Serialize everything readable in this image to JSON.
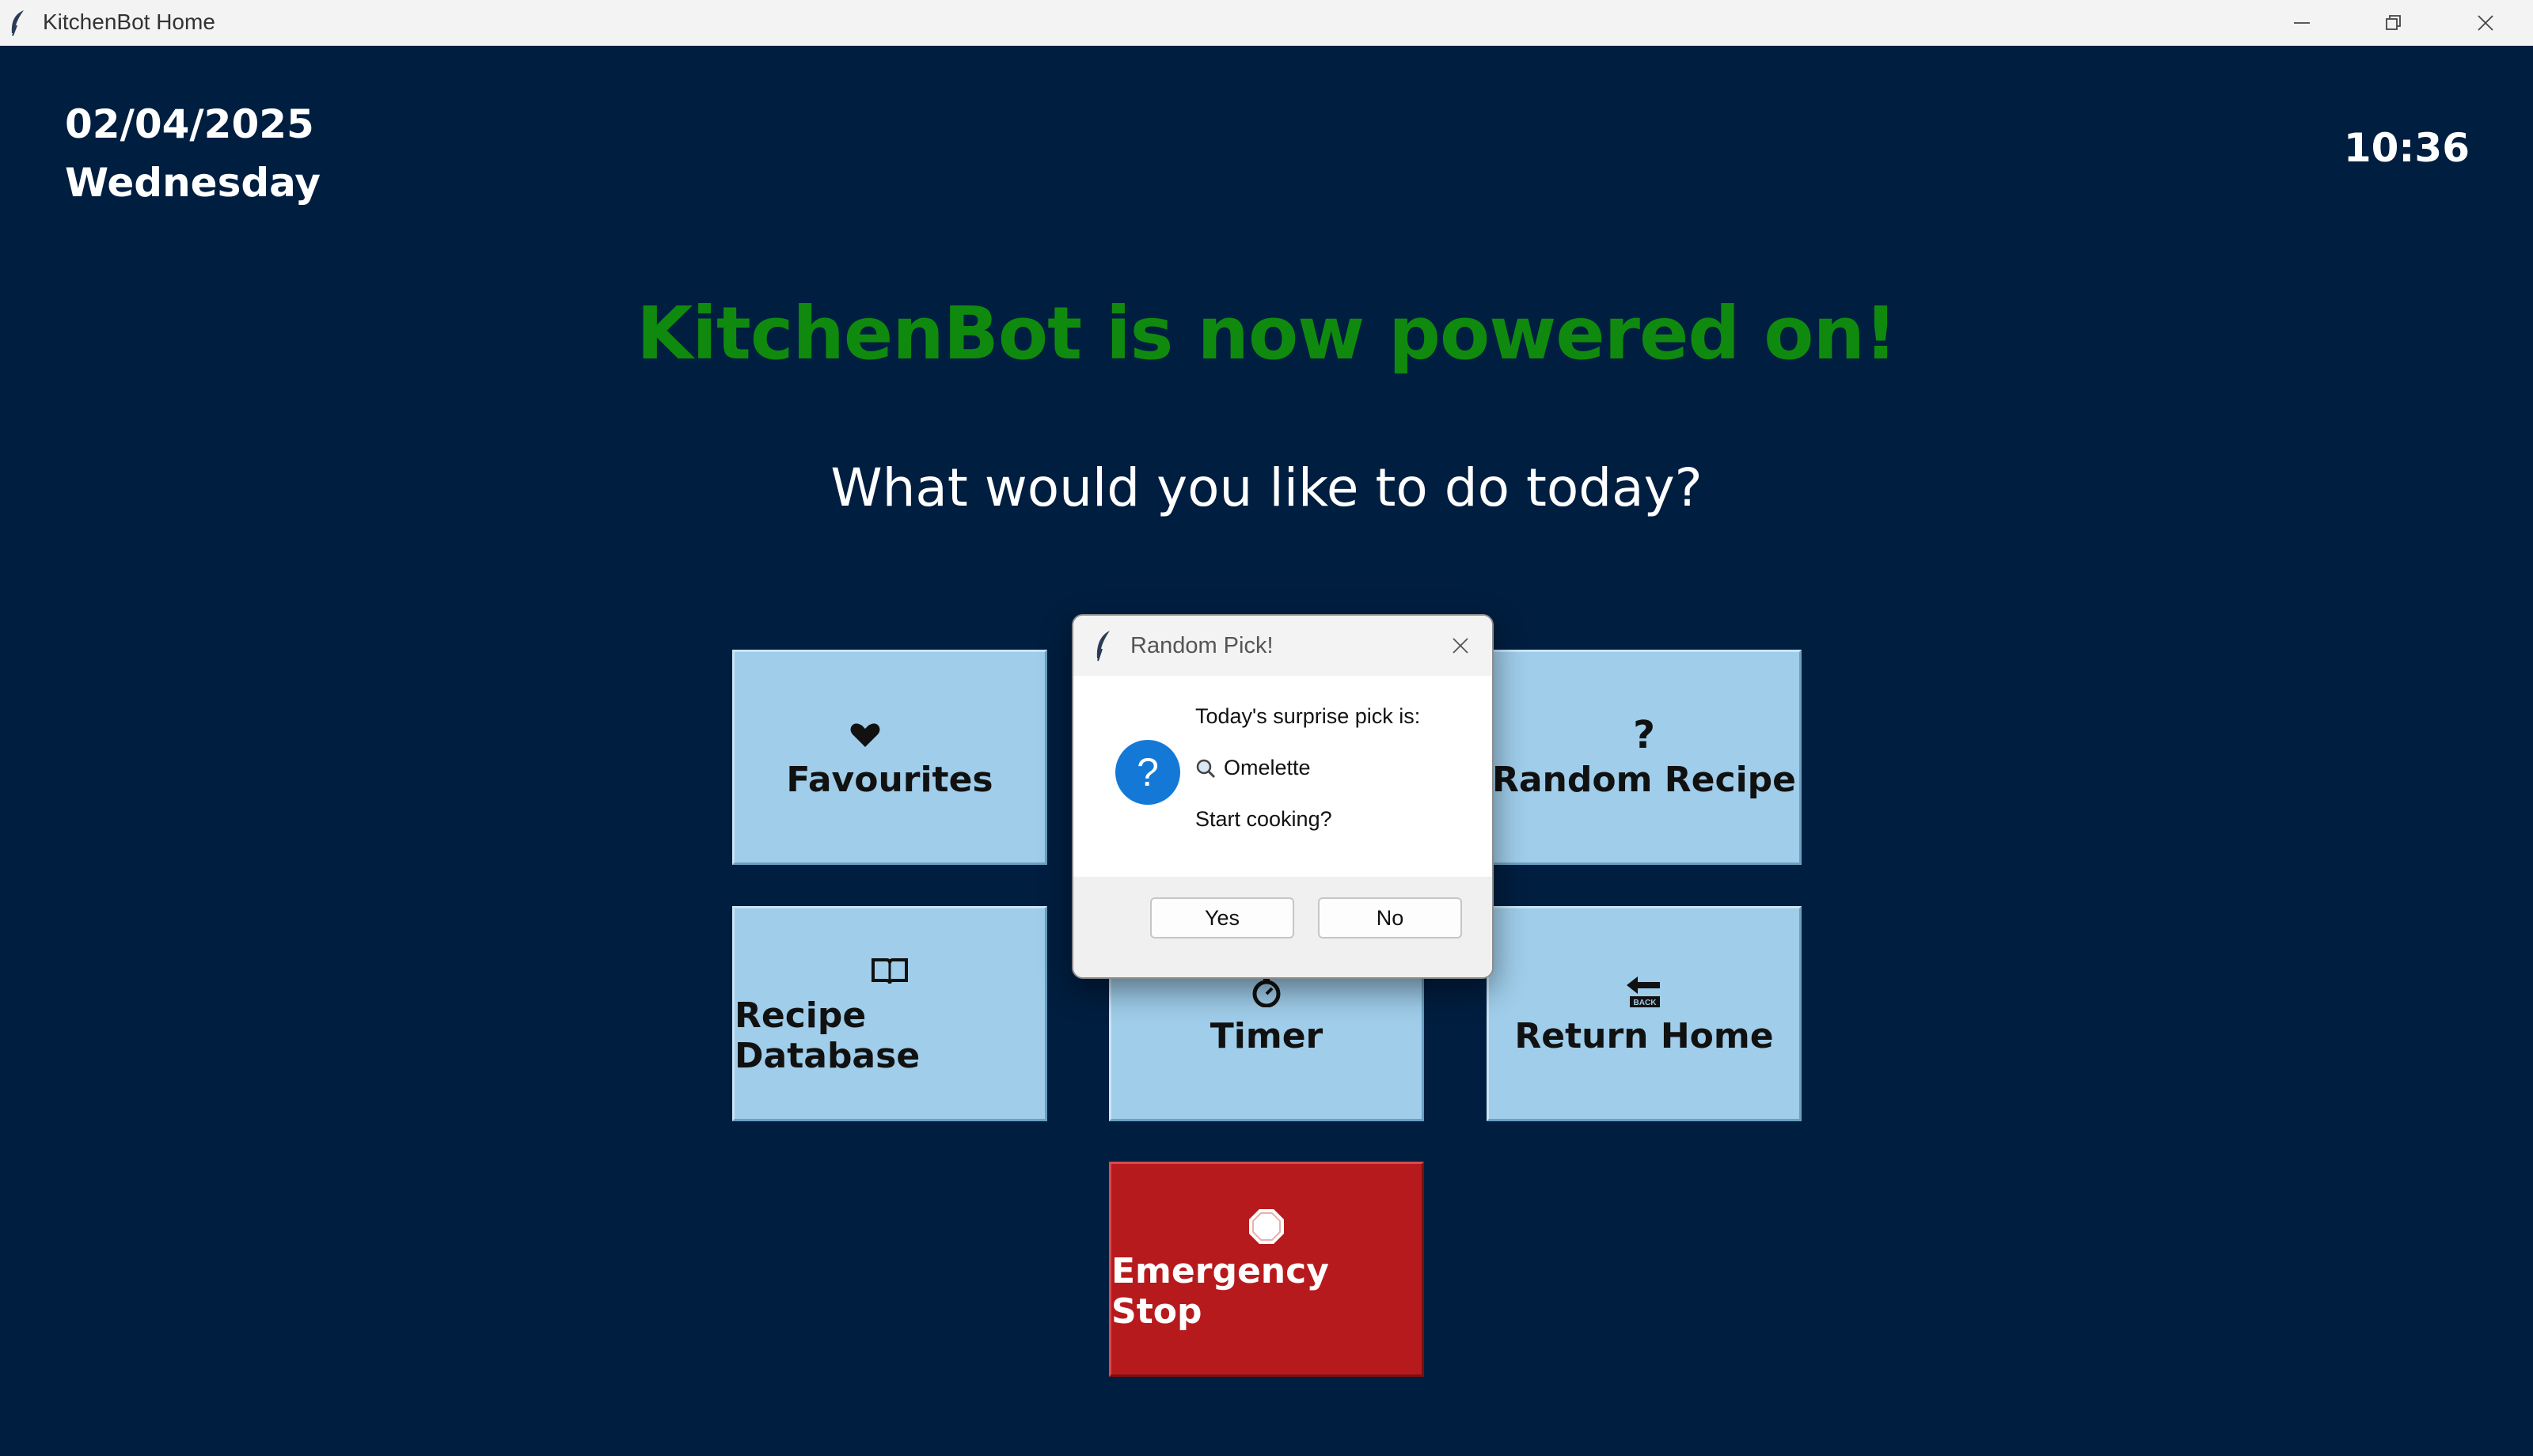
{
  "window": {
    "title": "KitchenBot Home",
    "app_icon": "feather-icon",
    "controls": [
      "minimize-icon",
      "restore-icon",
      "close-icon"
    ]
  },
  "header": {
    "date": "02/04/2025",
    "weekday": "Wednesday",
    "time": "10:36"
  },
  "headline": {
    "text": "KitchenBot is now powered on!",
    "color": "#0f8a0f"
  },
  "prompt": "What would you like to do today?",
  "tiles": {
    "favourites": {
      "label": "Favourites",
      "icon": "heart-icon"
    },
    "random": {
      "label": "Random Recipe",
      "icon": "question-mark-icon"
    },
    "database": {
      "label": "Recipe Database",
      "icon": "book-icon"
    },
    "timer": {
      "label": "Timer",
      "icon": "stopwatch-icon"
    },
    "home": {
      "label": "Return Home",
      "icon": "back-arrow-icon"
    },
    "stop": {
      "label": "Emergency Stop",
      "icon": "stop-sign-icon"
    }
  },
  "colors": {
    "background": "#001e40",
    "tile": "#9fcdea",
    "stop": "#b71a1d"
  },
  "dialog": {
    "title": "Random Pick!",
    "icon": "question-icon",
    "line1": "Today's surprise pick is:",
    "pick_icon": "magnifier-icon",
    "pick": "Omelette",
    "line3": "Start cooking?",
    "yes": "Yes",
    "no": "No"
  }
}
